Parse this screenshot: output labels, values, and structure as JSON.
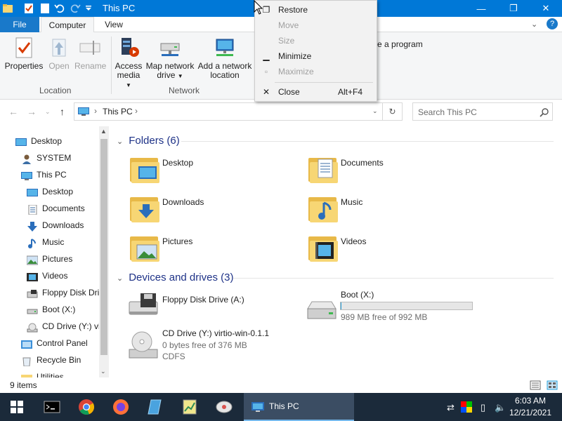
{
  "window": {
    "title": "This PC",
    "minimize_glyph": "—",
    "maximize_glyph": "❐",
    "close_glyph": "✕"
  },
  "ribbon": {
    "tabs": [
      "File",
      "Computer",
      "View"
    ],
    "buttons": {
      "properties": "Properties",
      "open": "Open",
      "rename": "Rename",
      "access_media": "Access media",
      "map_network_drive": "Map network drive",
      "add_network_location": "Add a network location",
      "uninstall_partial": "e a program"
    },
    "groups": {
      "location": "Location",
      "network": "Network"
    }
  },
  "address": {
    "crumb": "This PC",
    "search_placeholder": "Search This PC"
  },
  "nav_pane": {
    "items": [
      {
        "label": "Desktop",
        "icon": "desktop-icon"
      },
      {
        "label": "SYSTEM",
        "icon": "user-icon"
      },
      {
        "label": "This PC",
        "icon": "computer-icon"
      },
      {
        "label": "Desktop",
        "icon": "desktop-icon"
      },
      {
        "label": "Documents",
        "icon": "documents-icon"
      },
      {
        "label": "Downloads",
        "icon": "download-arrow-icon"
      },
      {
        "label": "Music",
        "icon": "music-note-icon"
      },
      {
        "label": "Pictures",
        "icon": "pictures-icon"
      },
      {
        "label": "Videos",
        "icon": "videos-icon"
      },
      {
        "label": "Floppy Disk Dri",
        "icon": "floppy-icon"
      },
      {
        "label": "Boot (X:)",
        "icon": "drive-icon"
      },
      {
        "label": "CD Drive (Y:) vi",
        "icon": "cd-icon"
      },
      {
        "label": "Control Panel",
        "icon": "control-panel-icon"
      },
      {
        "label": "Recycle Bin",
        "icon": "recycle-bin-icon"
      },
      {
        "label": "Utilities",
        "icon": "folder-icon"
      }
    ]
  },
  "content": {
    "folders_header": "Folders (6)",
    "folders": [
      {
        "label": "Desktop",
        "icon": "desktop-folder-icon"
      },
      {
        "label": "Documents",
        "icon": "documents-folder-icon"
      },
      {
        "label": "Downloads",
        "icon": "downloads-folder-icon"
      },
      {
        "label": "Music",
        "icon": "music-folder-icon"
      },
      {
        "label": "Pictures",
        "icon": "pictures-folder-icon"
      },
      {
        "label": "Videos",
        "icon": "videos-folder-icon"
      }
    ],
    "devices_header": "Devices and drives (3)",
    "drives": {
      "floppy": {
        "label": "Floppy Disk Drive (A:)"
      },
      "boot": {
        "label": "Boot (X:)",
        "free": "989 MB free of 992 MB",
        "used_fraction": 0.003
      },
      "cd": {
        "label": "CD Drive (Y:) virtio-win-0.1.1",
        "free": "0 bytes free of 376 MB",
        "fs": "CDFS"
      }
    }
  },
  "status": {
    "items": "9 items"
  },
  "context_menu": {
    "items": [
      {
        "label": "Restore",
        "icon": "restore-icon",
        "enabled": true
      },
      {
        "label": "Move",
        "enabled": false
      },
      {
        "label": "Size",
        "enabled": false
      },
      {
        "label": "Minimize",
        "icon": "minimize-icon",
        "enabled": true
      },
      {
        "label": "Maximize",
        "icon": "maximize-icon",
        "enabled": false
      },
      {
        "label": "Close",
        "icon": "close-icon",
        "accelerator": "Alt+F4",
        "enabled": true
      }
    ]
  },
  "taskbar": {
    "active_window": "This PC",
    "time": "6:03 AM",
    "date": "12/21/2021"
  },
  "colors": {
    "titlebar": "#0078d7",
    "taskbar": "#1b2a3a",
    "folder": "#f7d674",
    "section_header": "#1e3287"
  }
}
